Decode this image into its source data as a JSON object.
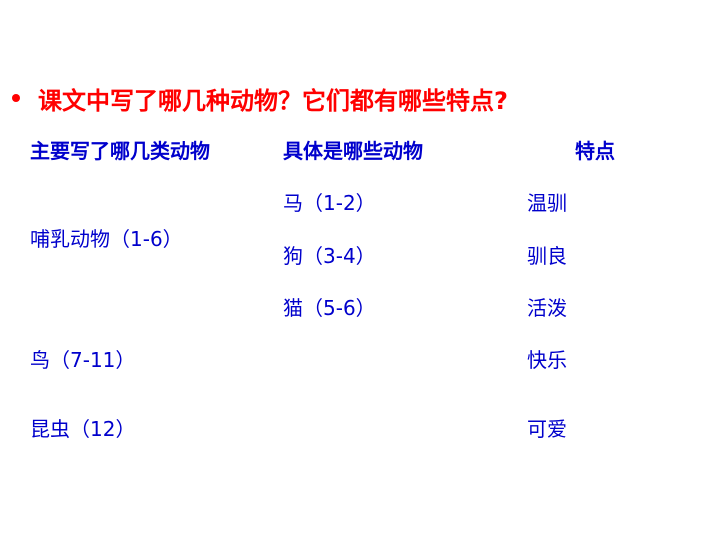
{
  "title": "课文中写了哪几种动物？它们都有哪些特点?",
  "headers": {
    "col1": "主要写了哪几类动物",
    "col2": "具体是哪些动物",
    "col3": "特点"
  },
  "rows": {
    "mammal_group": "哺乳动物（1-6）",
    "horse": "马（1-2）",
    "horse_trait": "温驯",
    "dog": "狗（3-4）",
    "dog_trait": "驯良",
    "cat": "猫（5-6）",
    "cat_trait": "活泼",
    "bird_group": "鸟（7-11）",
    "bird_trait": "快乐",
    "insect_group": "昆虫（12）",
    "insect_trait": "可爱"
  },
  "colors": {
    "title": "#ff0000",
    "body": "#0000cc"
  }
}
